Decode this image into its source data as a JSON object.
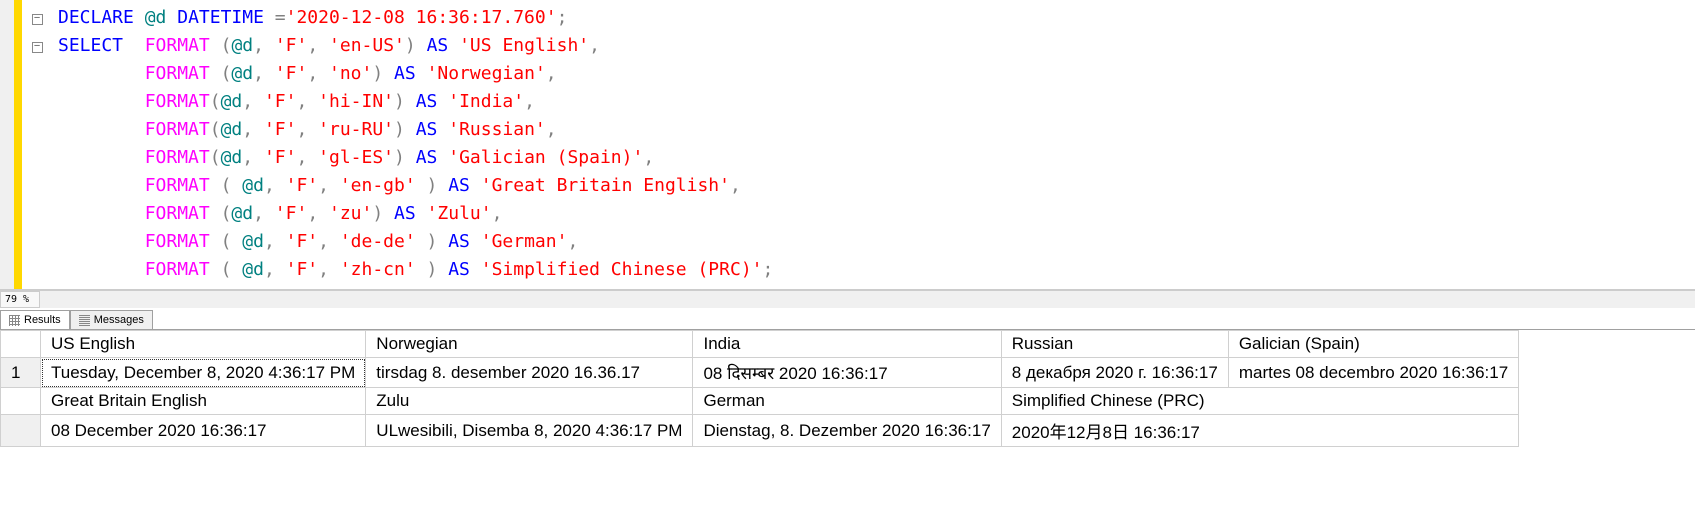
{
  "zoom": "79 %",
  "gutter": {
    "collapse1": "−",
    "collapse2": "−"
  },
  "code": {
    "l1_declare": "DECLARE",
    "l1_var": "@d",
    "l1_type": "DATETIME",
    "l1_eq": " =",
    "l1_str": "'2020-12-08 16:36:17.760'",
    "l1_semi": ";",
    "l2_select": "SELECT",
    "fmt": "FORMAT",
    "l2_open": " (",
    "var": "@d",
    "comma_sp": ", ",
    "fstr": "'F'",
    "l2_loc": "'en-US'",
    "close_sp": ") ",
    "as": "AS",
    "l2_alias": "'US English'",
    "comma": ",",
    "l3_loc": "'no'",
    "l3_alias": "'Norwegian'",
    "l4_open": "(",
    "l4_loc": "'hi-IN'",
    "l4_alias": "'India'",
    "l5_loc": "'ru-RU'",
    "l5_alias": "'Russian'",
    "l6_loc": "'gl-ES'",
    "l6_alias": "'Galician (Spain)'",
    "l7_open": " ( ",
    "l7_loc": "'en-gb'",
    "l7_close": " ) ",
    "l7_alias": "'Great Britain English'",
    "l8_loc": "'zu'",
    "l8_alias": "'Zulu'",
    "l9_loc": "'de-de'",
    "l9_alias": "'German'",
    "l10_loc": "'zh-cn'",
    "l10_alias": "'Simplified Chinese (PRC)'",
    "l10_semi": ";"
  },
  "tabs": {
    "results": "Results",
    "messages": "Messages"
  },
  "grid": {
    "headers1": [
      "US English",
      "Norwegian",
      "India",
      "Russian",
      "Galician (Spain)"
    ],
    "row1_num": "1",
    "row1": [
      "Tuesday, December 8, 2020 4:36:17 PM",
      "tirsdag 8. desember 2020 16.36.17",
      "08 दिसम्बर 2020 16:36:17",
      "8 декабря 2020 г. 16:36:17",
      "martes 08 decembro 2020 16:36:17"
    ],
    "headers2": [
      "Great Britain English",
      "Zulu",
      "German",
      "Simplified Chinese (PRC)"
    ],
    "row2": [
      "08 December 2020 16:36:17",
      "ULwesibili, Disemba 8, 2020 4:36:17 PM",
      "Dienstag, 8. Dezember 2020 16:36:17",
      "2020年12月8日 16:36:17"
    ]
  }
}
